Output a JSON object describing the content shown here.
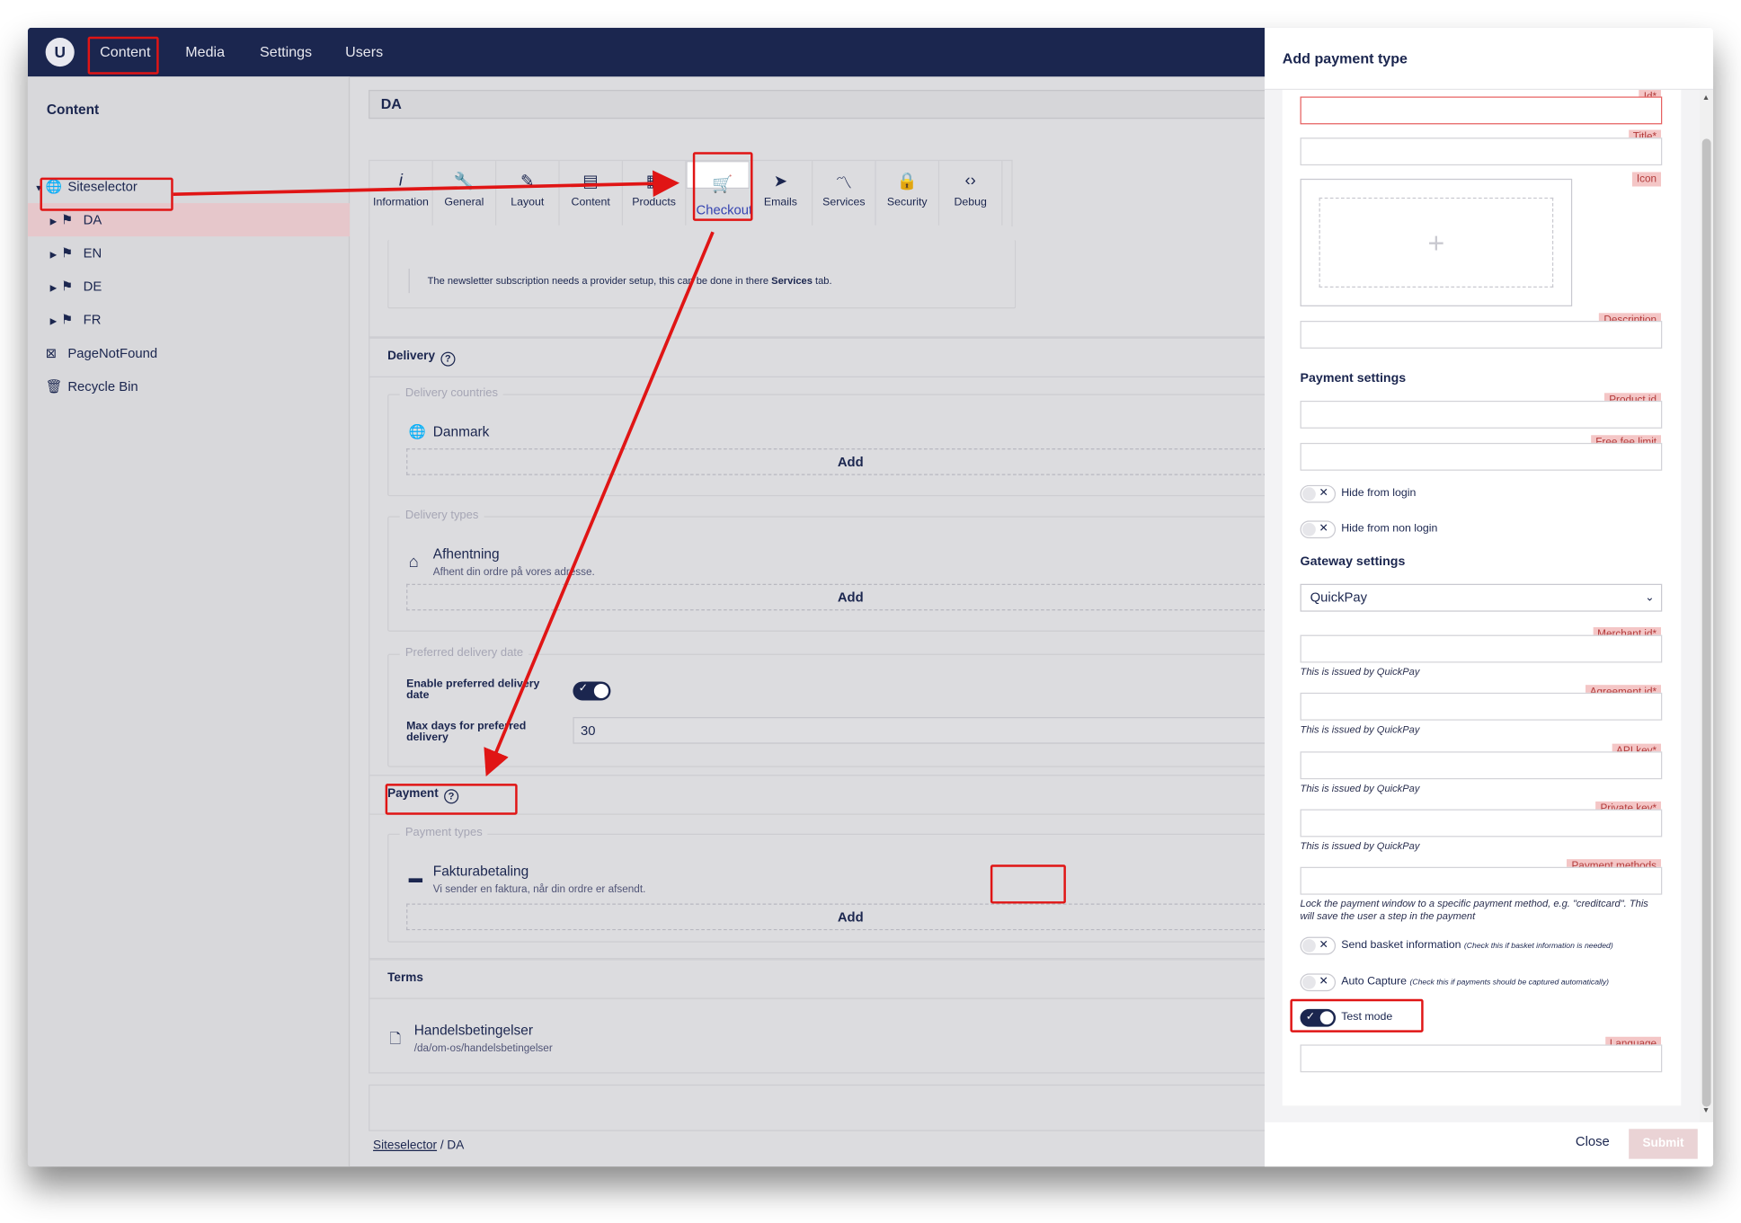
{
  "topnav": {
    "items": [
      "Content",
      "Media",
      "Settings",
      "Users"
    ],
    "logo": "U"
  },
  "tree": {
    "title": "Content",
    "root": "Siteselector",
    "children": [
      "DA",
      "EN",
      "DE",
      "FR"
    ],
    "extra": [
      "PageNotFound",
      "Recycle Bin"
    ]
  },
  "node": {
    "name": "DA"
  },
  "tabs": [
    "Information",
    "General",
    "Layout",
    "Content",
    "Products",
    "Checkout",
    "Emails",
    "Services",
    "Security",
    "Debug"
  ],
  "newsletter_note": {
    "text": "The newsletter subscription needs a provider setup, this can be done in there ",
    "link": "Services",
    "suffix": " tab."
  },
  "delivery": {
    "heading": "Delivery",
    "countries_legend": "Delivery countries",
    "country": "Danmark",
    "add": "Add",
    "types_legend": "Delivery types",
    "type_title": "Afhentning",
    "type_sub": "Afhent din ordre på vores adresse.",
    "date_legend": "Preferred delivery date",
    "enable_label": "Enable preferred delivery date",
    "max_label": "Max days for preferred delivery",
    "max_value": "30"
  },
  "payment": {
    "heading": "Payment",
    "types_legend": "Payment types",
    "type_title": "Fakturabetaling",
    "type_sub": "Vi sender en faktura, når din ordre er afsendt.",
    "add": "Add"
  },
  "terms": {
    "heading": "Terms",
    "title": "Handelsbetingelser",
    "path": "/da/om-os/handelsbetingelser"
  },
  "breadcrumb": {
    "root": "Siteselector",
    "sep": "/",
    "current": "DA"
  },
  "drawer": {
    "title": "Add payment type",
    "labels": {
      "id": "Id*",
      "title": "Title*",
      "icon": "Icon",
      "description": "Description",
      "product_id": "Product id",
      "free_fee": "Free fee limit",
      "merchant": "Merchant id*",
      "agreement": "Agreement id*",
      "api": "API key*",
      "private": "Private key*",
      "methods": "Payment methods",
      "language": "Language"
    },
    "payment_settings": "Payment settings",
    "gateway_settings": "Gateway settings",
    "gateway": "QuickPay",
    "issued_hint": "This is issued by QuickPay",
    "methods_hint": "Lock the payment window to a specific payment method, e.g. \"creditcard\". This will save the user a step in the payment",
    "toggles": {
      "hide_login": "Hide from login",
      "hide_non_login": "Hide from non login",
      "send_basket": "Send basket information",
      "send_basket_note": "(Check this if basket information is needed)",
      "auto_capture": "Auto Capture",
      "auto_capture_note": "(Check this if payments should be captured automatically)",
      "test_mode": "Test mode"
    },
    "close": "Close",
    "submit": "Submit"
  },
  "colors": {
    "navy": "#1b264f",
    "annotation": "#e01515",
    "label_bg": "#f4c6c6"
  }
}
